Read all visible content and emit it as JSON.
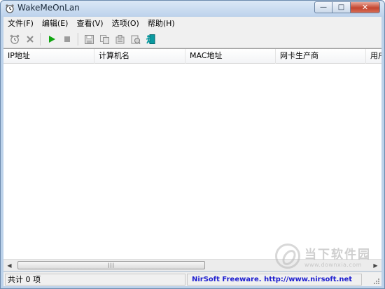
{
  "window": {
    "title": "WakeMeOnLan",
    "minimize_label": "—",
    "maximize_label": "□",
    "close_label": "✕"
  },
  "menu": {
    "items": [
      {
        "label": "文件(F)"
      },
      {
        "label": "编辑(E)"
      },
      {
        "label": "查看(V)"
      },
      {
        "label": "选项(O)"
      },
      {
        "label": "帮助(H)"
      }
    ]
  },
  "toolbar": {
    "buttons": [
      {
        "icon": "alarm-clock-icon"
      },
      {
        "icon": "delete-x-icon"
      },
      {
        "icon": "play-icon",
        "color": "#12a612"
      },
      {
        "icon": "stop-icon"
      },
      {
        "icon": "save-icon"
      },
      {
        "icon": "copy-icon"
      },
      {
        "icon": "properties-icon"
      },
      {
        "icon": "refresh-icon"
      },
      {
        "icon": "exit-icon",
        "color": "#0a9aa0"
      }
    ]
  },
  "list": {
    "columns": [
      {
        "label": "IP地址"
      },
      {
        "label": "计算机名"
      },
      {
        "label": "MAC地址"
      },
      {
        "label": "网卡生产商"
      },
      {
        "label": "用户"
      }
    ],
    "rows": []
  },
  "scrollbar": {
    "left_arrow": "◀",
    "right_arrow": "▶",
    "thumb_grip": "|||"
  },
  "status": {
    "count_text": "共计 0 项",
    "link_text": "NirSoft Freeware.  http://www.nirsoft.net",
    "link_color": "#1e1ecf"
  },
  "watermark": {
    "name": "当下软件园",
    "url": "www.downxia.com"
  }
}
